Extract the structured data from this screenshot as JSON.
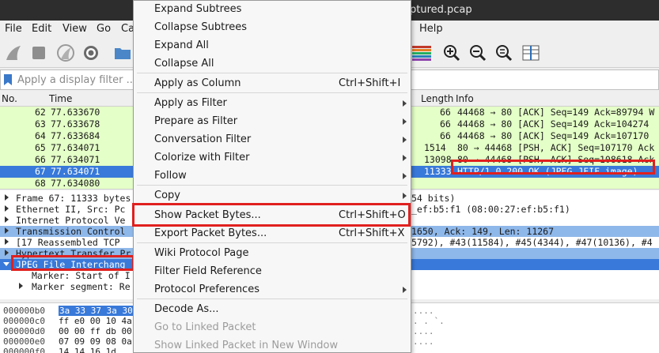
{
  "window": {
    "title_fragment": "ptured.pcap"
  },
  "menubar": {
    "file": "File",
    "edit": "Edit",
    "view": "View",
    "go": "Go",
    "capture_fragment": "Ca",
    "help": "Help"
  },
  "filter": {
    "placeholder": "Apply a display filter ..."
  },
  "packet_list": {
    "headers": {
      "no": "No.",
      "time": "Time",
      "length": "Length",
      "info": "Info"
    },
    "rows": [
      {
        "no": "62",
        "time": "77.633670",
        "length": "66",
        "info": "44468 → 80 [ACK] Seq=149 Ack=89794 W"
      },
      {
        "no": "63",
        "time": "77.633678",
        "length": "66",
        "info": "44468 → 80 [ACK] Seq=149 Ack=104274"
      },
      {
        "no": "64",
        "time": "77.633684",
        "length": "66",
        "info": "44468 → 80 [ACK] Seq=149 Ack=107170"
      },
      {
        "no": "65",
        "time": "77.634071",
        "length": "1514",
        "info": "80 → 44468 [PSH, ACK] Seq=107170 Ack"
      },
      {
        "no": "66",
        "time": "77.634071",
        "length": "13098",
        "info": "80 → 44468 [PSH, ACK] Seq=108618 Ack"
      },
      {
        "no": "67",
        "time": "77.634071",
        "length": "11333",
        "info": "HTTP/1.0 200 OK  (JPEG JFIF image)"
      },
      {
        "no": "68",
        "time": "77.634080",
        "length": "",
        "info": ""
      }
    ]
  },
  "details": {
    "rows": [
      {
        "left": "Frame 67: 11333 bytes",
        "right": "54 bits)"
      },
      {
        "left": "Ethernet II, Src: Pc",
        "right": "_ef:b5:f1 (08:00:27:ef:b5:f1)"
      },
      {
        "left": "Internet Protocol Ve",
        "right": ""
      },
      {
        "left": "Transmission Control",
        "right": "1650, Ack: 149, Len: 11267"
      },
      {
        "left": "[17 Reassembled TCP",
        "right": "5792), #43(11584), #45(4344), #47(10136), #4"
      },
      {
        "left": "Hypertext Transfer Pr",
        "right": ""
      },
      {
        "left": "JPEG File Interchang",
        "right": ""
      },
      {
        "left": "Marker: Start of I",
        "right": ""
      },
      {
        "left": "Marker segment: Re",
        "right": ""
      }
    ]
  },
  "hex": {
    "rows": [
      {
        "offset": "000000b0",
        "bytes": "3a 33 37 3a 30",
        "ascii": "...."
      },
      {
        "offset": "000000c0",
        "bytes": "ff e0 00 10 4a",
        "ascii": ". . `."
      },
      {
        "offset": "000000d0",
        "bytes": "00 00 ff db 00",
        "ascii": "...."
      },
      {
        "offset": "000000e0",
        "bytes": "07 09 09 08 0a",
        "ascii": "...."
      },
      {
        "offset": "000000f0",
        "bytes": "14 14 16 1d",
        "ascii": "...."
      }
    ]
  },
  "context_menu": {
    "items": [
      {
        "label": "Expand Subtrees",
        "shortcut": "",
        "submenu": false,
        "disabled": false
      },
      {
        "label": "Collapse Subtrees",
        "shortcut": "",
        "submenu": false,
        "disabled": false
      },
      {
        "label": "Expand All",
        "shortcut": "",
        "submenu": false,
        "disabled": false
      },
      {
        "label": "Collapse All",
        "shortcut": "",
        "submenu": false,
        "disabled": false
      },
      {
        "label": "Apply as Column",
        "shortcut": "Ctrl+Shift+I",
        "submenu": false,
        "disabled": false
      },
      {
        "label": "Apply as Filter",
        "shortcut": "",
        "submenu": true,
        "disabled": false
      },
      {
        "label": "Prepare as Filter",
        "shortcut": "",
        "submenu": true,
        "disabled": false
      },
      {
        "label": "Conversation Filter",
        "shortcut": "",
        "submenu": true,
        "disabled": false
      },
      {
        "label": "Colorize with Filter",
        "shortcut": "",
        "submenu": true,
        "disabled": false
      },
      {
        "label": "Follow",
        "shortcut": "",
        "submenu": true,
        "disabled": false
      },
      {
        "label": "Copy",
        "shortcut": "",
        "submenu": true,
        "disabled": false
      },
      {
        "label": "Show Packet Bytes...",
        "shortcut": "Ctrl+Shift+O",
        "submenu": false,
        "disabled": false
      },
      {
        "label": "Export Packet Bytes...",
        "shortcut": "Ctrl+Shift+X",
        "submenu": false,
        "disabled": false
      },
      {
        "label": "Wiki Protocol Page",
        "shortcut": "",
        "submenu": false,
        "disabled": false
      },
      {
        "label": "Filter Field Reference",
        "shortcut": "",
        "submenu": false,
        "disabled": false
      },
      {
        "label": "Protocol Preferences",
        "shortcut": "",
        "submenu": true,
        "disabled": false
      },
      {
        "label": "Decode As...",
        "shortcut": "",
        "submenu": false,
        "disabled": false
      },
      {
        "label": "Go to Linked Packet",
        "shortcut": "",
        "submenu": false,
        "disabled": true
      },
      {
        "label": "Show Linked Packet in New Window",
        "shortcut": "",
        "submenu": false,
        "disabled": true
      }
    ]
  },
  "icons": [
    "shark-fin-icon",
    "stop-icon",
    "restart-icon",
    "options-gear-icon",
    "open-folder-icon",
    "colorize-icon",
    "zoom-in-icon",
    "zoom-out-icon",
    "zoom-reset-icon",
    "resize-columns-icon",
    "bookmark-icon"
  ],
  "colors": {
    "selection": "#3879d9",
    "tcp_row": "#e4ffc7",
    "highlight_box": "#e0201e",
    "menu_bg": "#f7f7f7"
  }
}
